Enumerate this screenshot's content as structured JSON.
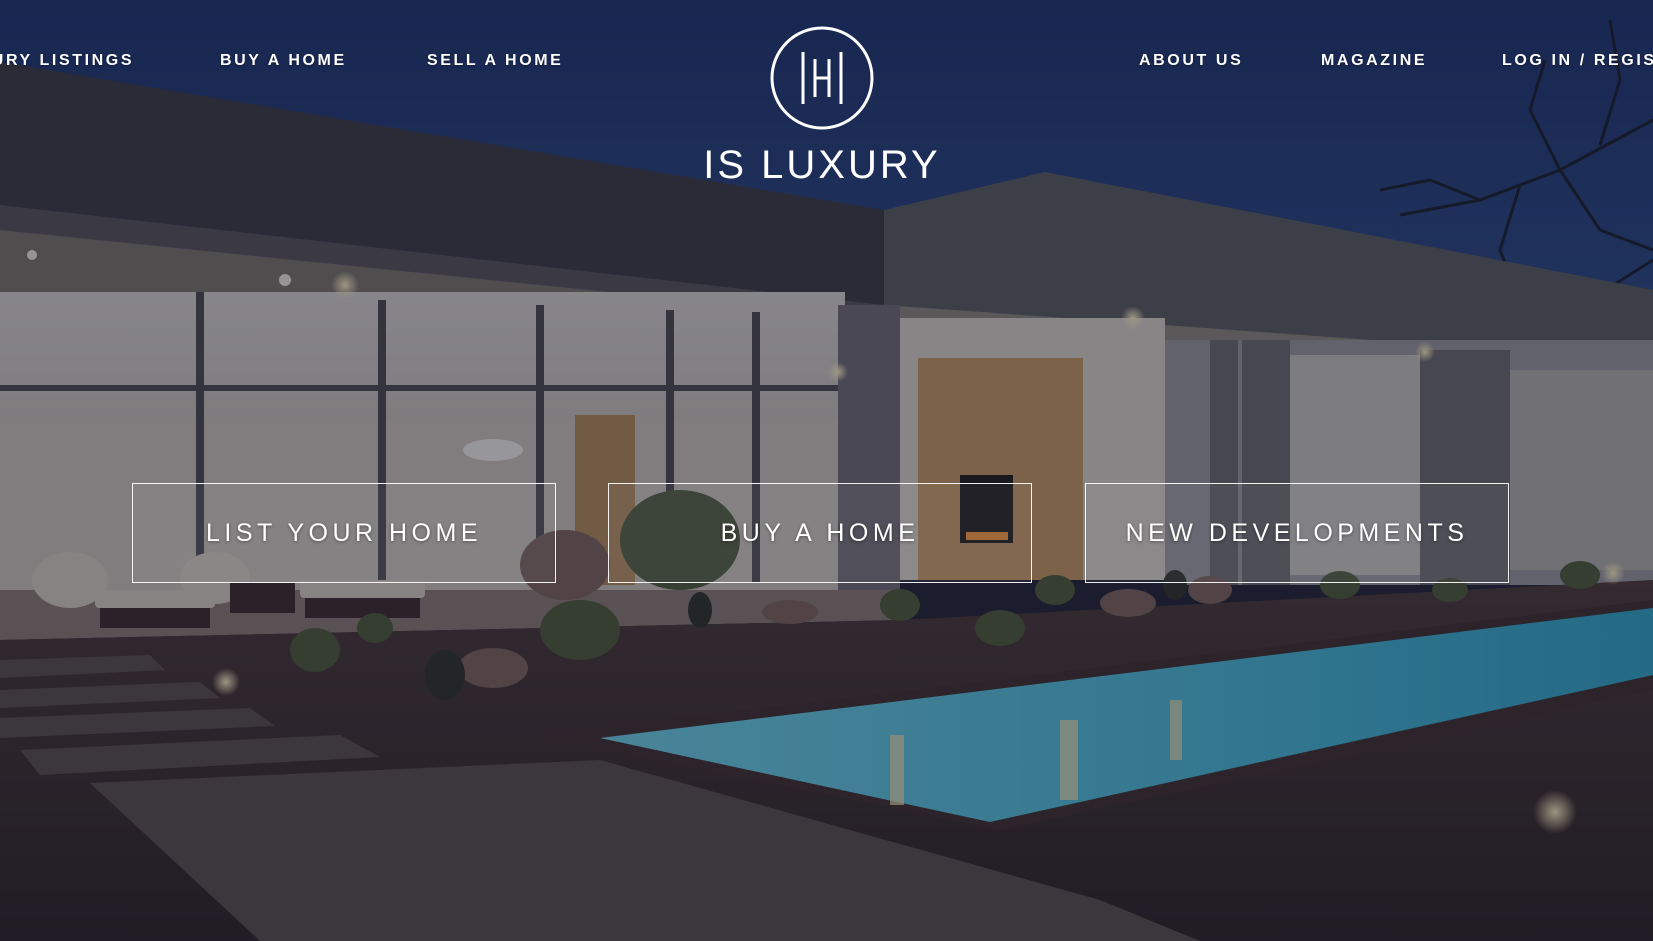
{
  "nav": {
    "left": [
      {
        "label": "LUXURY LISTINGS"
      },
      {
        "label": "BUY A HOME"
      },
      {
        "label": "SELL A HOME"
      }
    ],
    "right": [
      {
        "label": "ABOUT US"
      },
      {
        "label": "MAGAZINE"
      },
      {
        "label": "LOG IN / REGISTER"
      }
    ]
  },
  "logo": {
    "text": "IS LUXURY",
    "mark": "IS monogram in circle"
  },
  "cta": [
    {
      "label": "LIST YOUR HOME"
    },
    {
      "label": "BUY A HOME"
    },
    {
      "label": "NEW DEVELOPMENTS"
    }
  ],
  "colors": {
    "sky": "#1e3a75",
    "text": "#ffffff",
    "pool": "#47c6e4",
    "overlay": "#1d1c2c"
  }
}
